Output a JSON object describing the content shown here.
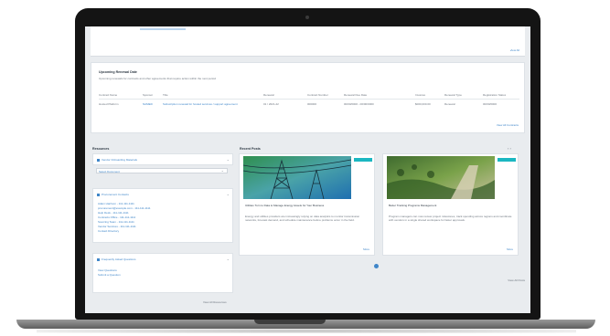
{
  "top_panel": {
    "more_link": "View All"
  },
  "upcoming": {
    "title": "Upcoming Renewal Date",
    "description": "Upcoming renewals for contracts and other agreements that require action within the next period",
    "columns": [
      "Contract Name",
      "Sponsor",
      "Title",
      "Renewal",
      "Contract Number",
      "Renewal Due Date",
      "Invoices",
      "Renewal Type",
      "Registration Status"
    ],
    "row": [
      "Hosted Platform",
      "NAMED",
      "Subscription renewal for hosted services / support agreement",
      "01 / 2021-22",
      "000000",
      "00/00/0000 - 00/00/0000",
      "$000,000.00",
      "Renewal",
      "00/00/0000"
    ],
    "more_link": "View All Contracts"
  },
  "resources": {
    "title": "Resources",
    "sections": [
      {
        "label": "Vendor Onboarding Materials",
        "field": "Select Document"
      },
      {
        "label": "Procurement Contacts",
        "lines": [
          "Adam Harrison - 111-111-1111",
          "procurement@example.com - 111-111-1111",
          "Help Desk - 111-111-1111",
          "Contracts Office - 111-111-1111",
          "Sourcing Team - 111-111-1111",
          "Vendor Services - 111-111-1111",
          "Contact Directory"
        ]
      },
      {
        "label": "Frequently Asked Questions",
        "lines": [
          "View Questions",
          "Submit a Question"
        ]
      }
    ],
    "view_all": "View All Resources"
  },
  "recent_posts": {
    "title": "Recent Posts",
    "nav": "‹ ›",
    "posts": [
      {
        "tag": "NEWS",
        "title": "Utilities Turn to Data to Manage Energy Assets for Your Business",
        "body": "Energy and utilities providers are increasingly relying on data analytics to monitor transmission networks, forecast demand, and schedule maintenance before problems occur in the field.",
        "more": "More"
      },
      {
        "tag": "NEWS",
        "title": "Better Tracking Programs Management",
        "body": "Program managers can now review project milestones, track spending across regions and coordinate with vendors in a single shared workspace for faster approvals.",
        "more": "More"
      }
    ],
    "view_all": "View All Posts"
  },
  "colors": {
    "accent": "#3f86c9",
    "tag": "#1bb7c1",
    "background": "#e9ecef"
  }
}
